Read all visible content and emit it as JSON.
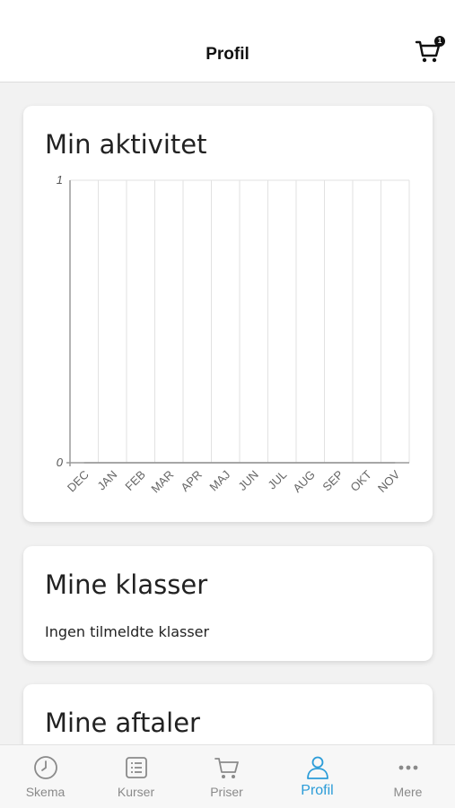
{
  "header": {
    "title": "Profil",
    "cart_count": "1"
  },
  "activity": {
    "title": "Min aktivitet",
    "chart_data": {
      "type": "line",
      "categories": [
        "DEC",
        "JAN",
        "FEB",
        "MAR",
        "APR",
        "MAJ",
        "JUN",
        "JUL",
        "AUG",
        "SEP",
        "OKT",
        "NOV"
      ],
      "values": [
        0,
        0,
        0,
        0,
        0,
        0,
        0,
        0,
        0,
        0,
        0,
        0
      ],
      "ylim": [
        0,
        1
      ],
      "yticks": [
        "1",
        "0"
      ],
      "grid": true
    }
  },
  "classes": {
    "title": "Mine klasser",
    "empty_text": "Ingen tilmeldte klasser"
  },
  "appointments": {
    "title": "Mine aftaler"
  },
  "tabs": [
    {
      "label": "Skema",
      "icon": "clock-icon",
      "active": false
    },
    {
      "label": "Kurser",
      "icon": "list-icon",
      "active": false
    },
    {
      "label": "Priser",
      "icon": "cart-icon",
      "active": false
    },
    {
      "label": "Profil",
      "icon": "user-icon",
      "active": true
    },
    {
      "label": "Mere",
      "icon": "more-icon",
      "active": false
    }
  ],
  "colors": {
    "accent": "#2b9cd8",
    "inactive": "#8a8a8a"
  }
}
